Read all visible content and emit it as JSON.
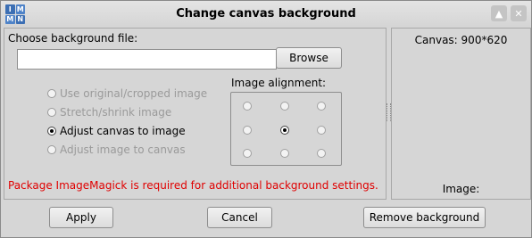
{
  "window": {
    "title": "Change canvas background",
    "app_icon_letters": [
      "I",
      "M",
      "M",
      "N"
    ],
    "app_icon_colors": [
      "#3c6fb4",
      "#3c6fb4",
      "#3c6fb4",
      "#3c6fb4"
    ]
  },
  "titlebar_buttons": {
    "maximize_icon": "up-arrow-icon",
    "close_icon": "close-icon"
  },
  "background_file": {
    "label": "Choose background file:",
    "value": "",
    "browse_label": "Browse"
  },
  "fit_options": [
    {
      "label": "Use original/cropped image",
      "checked": false,
      "enabled": false
    },
    {
      "label": "Stretch/shrink image",
      "checked": false,
      "enabled": false
    },
    {
      "label": "Adjust canvas to image",
      "checked": true,
      "enabled": true
    },
    {
      "label": "Adjust image to canvas",
      "checked": false,
      "enabled": false
    }
  ],
  "alignment": {
    "label": "Image alignment:",
    "selected": "center",
    "positions": [
      "top-left",
      "top",
      "top-right",
      "left",
      "center",
      "right",
      "bottom-left",
      "bottom",
      "bottom-right"
    ]
  },
  "warning": {
    "text": "Package ImageMagick is required for additional background settings.",
    "color": "#e00000"
  },
  "preview": {
    "canvas_text": "Canvas: 900*620",
    "image_label": "Image:"
  },
  "buttons": {
    "apply": "Apply",
    "cancel": "Cancel",
    "remove": "Remove background"
  }
}
